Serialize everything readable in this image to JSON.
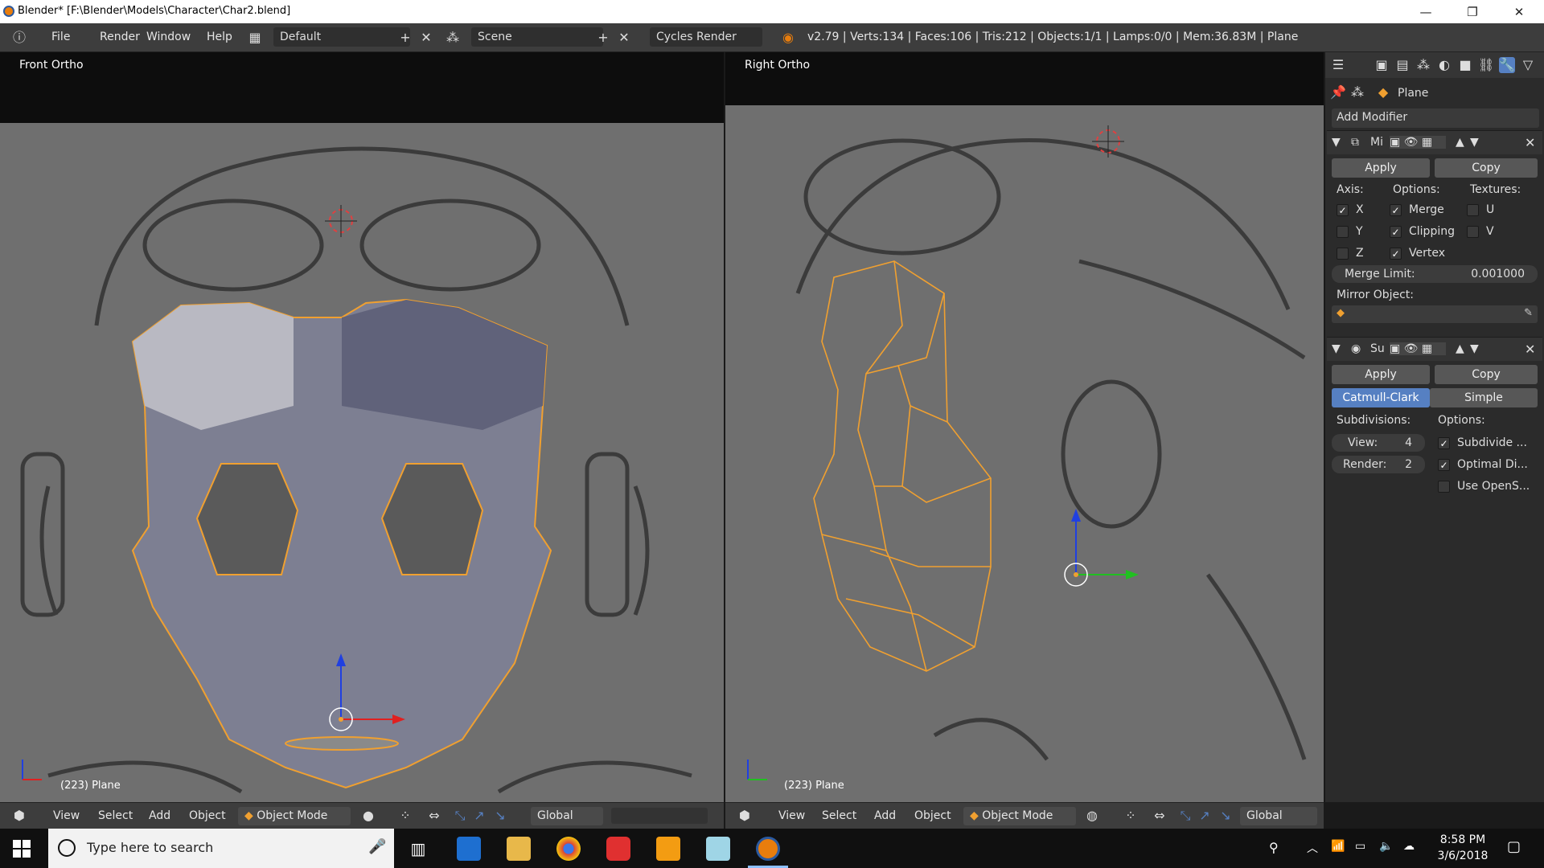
{
  "window": {
    "title": "Blender* [F:\\Blender\\Models\\Character\\Char2.blend]",
    "minimize": "—",
    "restore": "❐",
    "close": "✕"
  },
  "header": {
    "menus": [
      "File",
      "Render",
      "Window",
      "Help"
    ],
    "layout": "Default",
    "scene": "Scene",
    "engine": "Cycles Render",
    "stats": "v2.79 | Verts:134 | Faces:106 | Tris:212 | Objects:1/1 | Lamps:0/0 | Mem:36.83M | Plane"
  },
  "left_view": {
    "label": "Front Ortho",
    "footer": "(223) Plane",
    "menus": [
      "View",
      "Select",
      "Add",
      "Object"
    ],
    "mode": "Object Mode",
    "orientation": "Global"
  },
  "right_view": {
    "label": "Right Ortho",
    "footer": "(223) Plane",
    "menus": [
      "View",
      "Select",
      "Add",
      "Object"
    ],
    "mode": "Object Mode",
    "orientation": "Global"
  },
  "properties": {
    "object": "Plane",
    "add_modifier": "Add Modifier",
    "mirror": {
      "name": "Mi",
      "apply": "Apply",
      "copy": "Copy",
      "axis_label": "Axis:",
      "options_label": "Options:",
      "textures_label": "Textures:",
      "axes": [
        {
          "label": "X",
          "checked": true
        },
        {
          "label": "Y",
          "checked": false
        },
        {
          "label": "Z",
          "checked": false
        }
      ],
      "options": [
        {
          "label": "Merge",
          "checked": true
        },
        {
          "label": "Clipping",
          "checked": true
        },
        {
          "label": "Vertex",
          "checked": true
        }
      ],
      "textures": [
        {
          "label": "U",
          "checked": false
        },
        {
          "label": "V",
          "checked": false
        }
      ],
      "merge_limit_label": "Merge Limit:",
      "merge_limit": "0.001000",
      "mirror_object_label": "Mirror Object:"
    },
    "subsurf": {
      "name": "Su",
      "apply": "Apply",
      "copy": "Copy",
      "tab_catmull": "Catmull-Clark",
      "tab_simple": "Simple",
      "subdivisions_label": "Subdivisions:",
      "options_label": "Options:",
      "view_label": "View:",
      "view_value": "4",
      "render_label": "Render:",
      "render_value": "2",
      "options": [
        {
          "label": "Subdivide ...",
          "checked": true
        },
        {
          "label": "Optimal Di...",
          "checked": true
        },
        {
          "label": "Use OpenS...",
          "checked": false
        }
      ]
    }
  },
  "taskbar": {
    "search_placeholder": "Type here to search",
    "time": "8:58 PM",
    "date": "3/6/2018"
  },
  "colors": {
    "accent": "#5680c2",
    "selection": "#f0a030",
    "viewport_bg": "#6f6f6f"
  }
}
